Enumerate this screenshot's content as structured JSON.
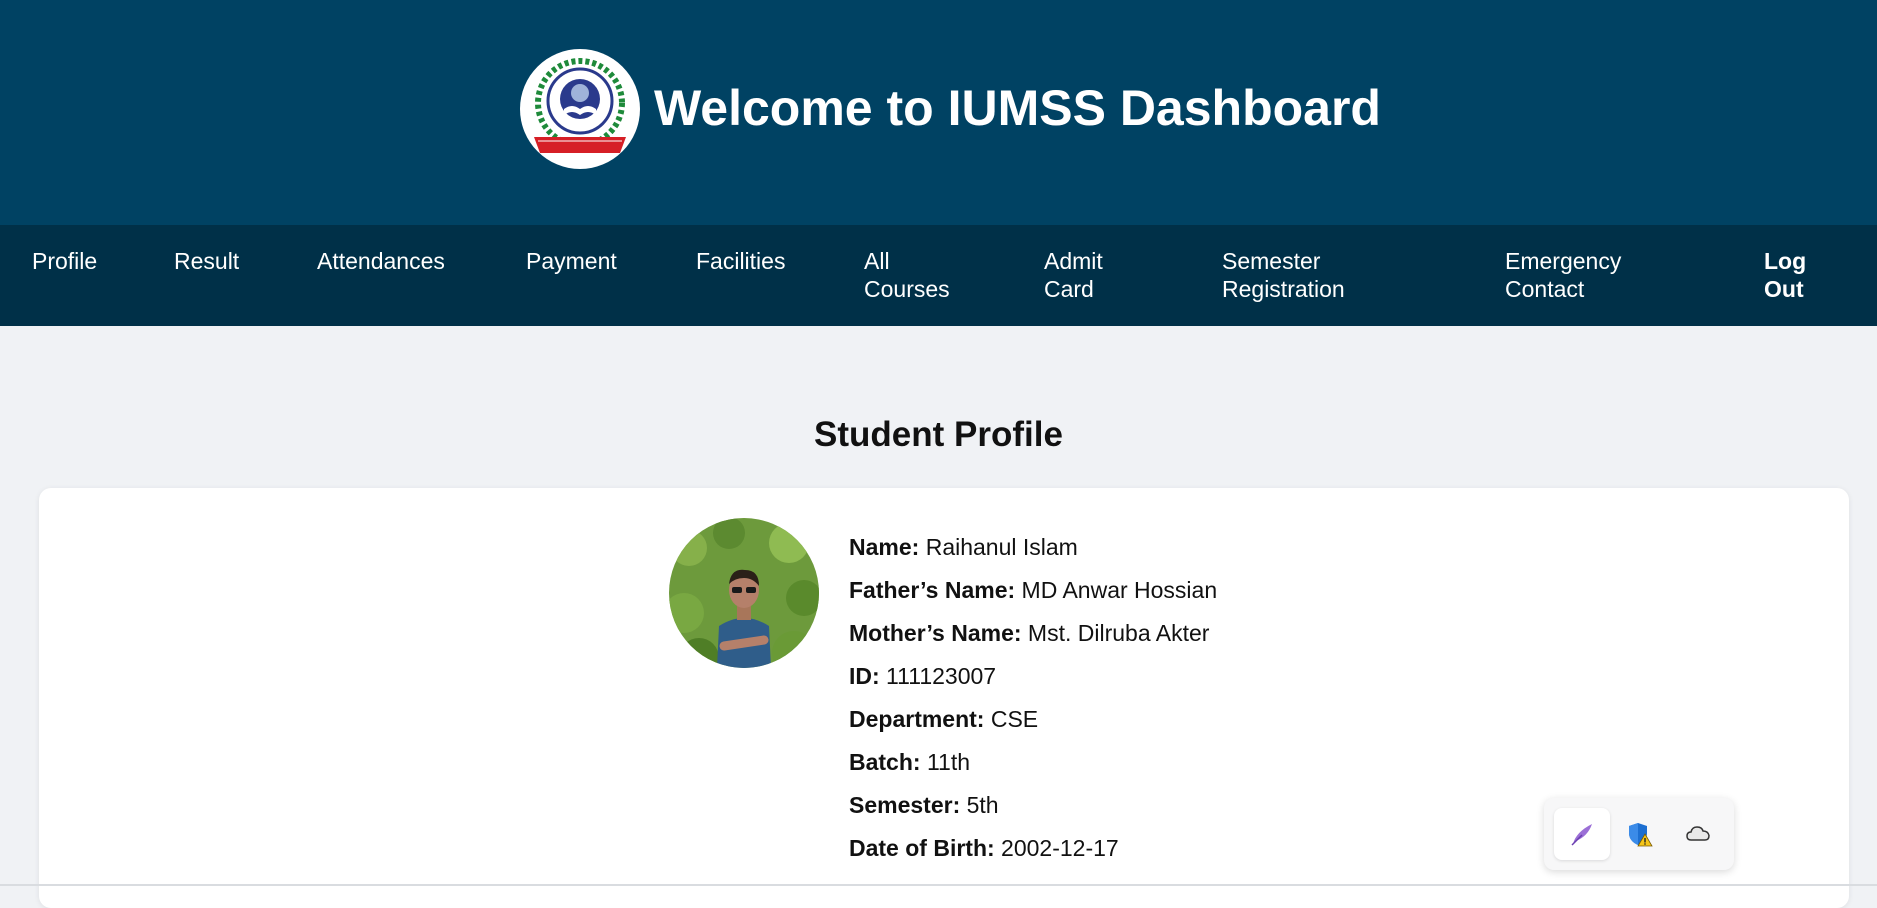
{
  "header": {
    "title": "Welcome to IUMSS Dashboard",
    "logo_alt": "University logo KOTBARI, CUMILLA"
  },
  "nav": {
    "items": [
      {
        "label_line1": "Profile",
        "label_line2": ""
      },
      {
        "label_line1": "Result",
        "label_line2": ""
      },
      {
        "label_line1": "Attendances",
        "label_line2": ""
      },
      {
        "label_line1": "Payment",
        "label_line2": ""
      },
      {
        "label_line1": "Facilities",
        "label_line2": ""
      },
      {
        "label_line1": "All",
        "label_line2": "Courses"
      },
      {
        "label_line1": "Admit",
        "label_line2": "Card"
      },
      {
        "label_line1": "Semester",
        "label_line2": "Registration"
      },
      {
        "label_line1": "Emergency",
        "label_line2": "Contact"
      },
      {
        "label_line1": "Log",
        "label_line2": "Out"
      }
    ]
  },
  "profile": {
    "page_title": "Student Profile",
    "fields": [
      {
        "label": "Name:",
        "value": " Raihanul Islam"
      },
      {
        "label": "Father’s Name:",
        "value": " MD Anwar Hossian"
      },
      {
        "label": "Mother’s Name:",
        "value": " Mst. Dilruba Akter"
      },
      {
        "label": "ID:",
        "value": " 111123007"
      },
      {
        "label": "Department:",
        "value": " CSE"
      },
      {
        "label": "Batch:",
        "value": " 11th"
      },
      {
        "label": "Semester:",
        "value": " 5th"
      },
      {
        "label": "Date of Birth:",
        "value": " 2002-12-17"
      }
    ]
  },
  "tray": {
    "icons": [
      "feather-pen-icon",
      "shield-warning-icon",
      "cloud-icon"
    ]
  },
  "colors": {
    "header_bg": "#004263",
    "nav_bg": "#003048",
    "page_bg": "#f0f2f5",
    "card_bg": "#ffffff"
  }
}
